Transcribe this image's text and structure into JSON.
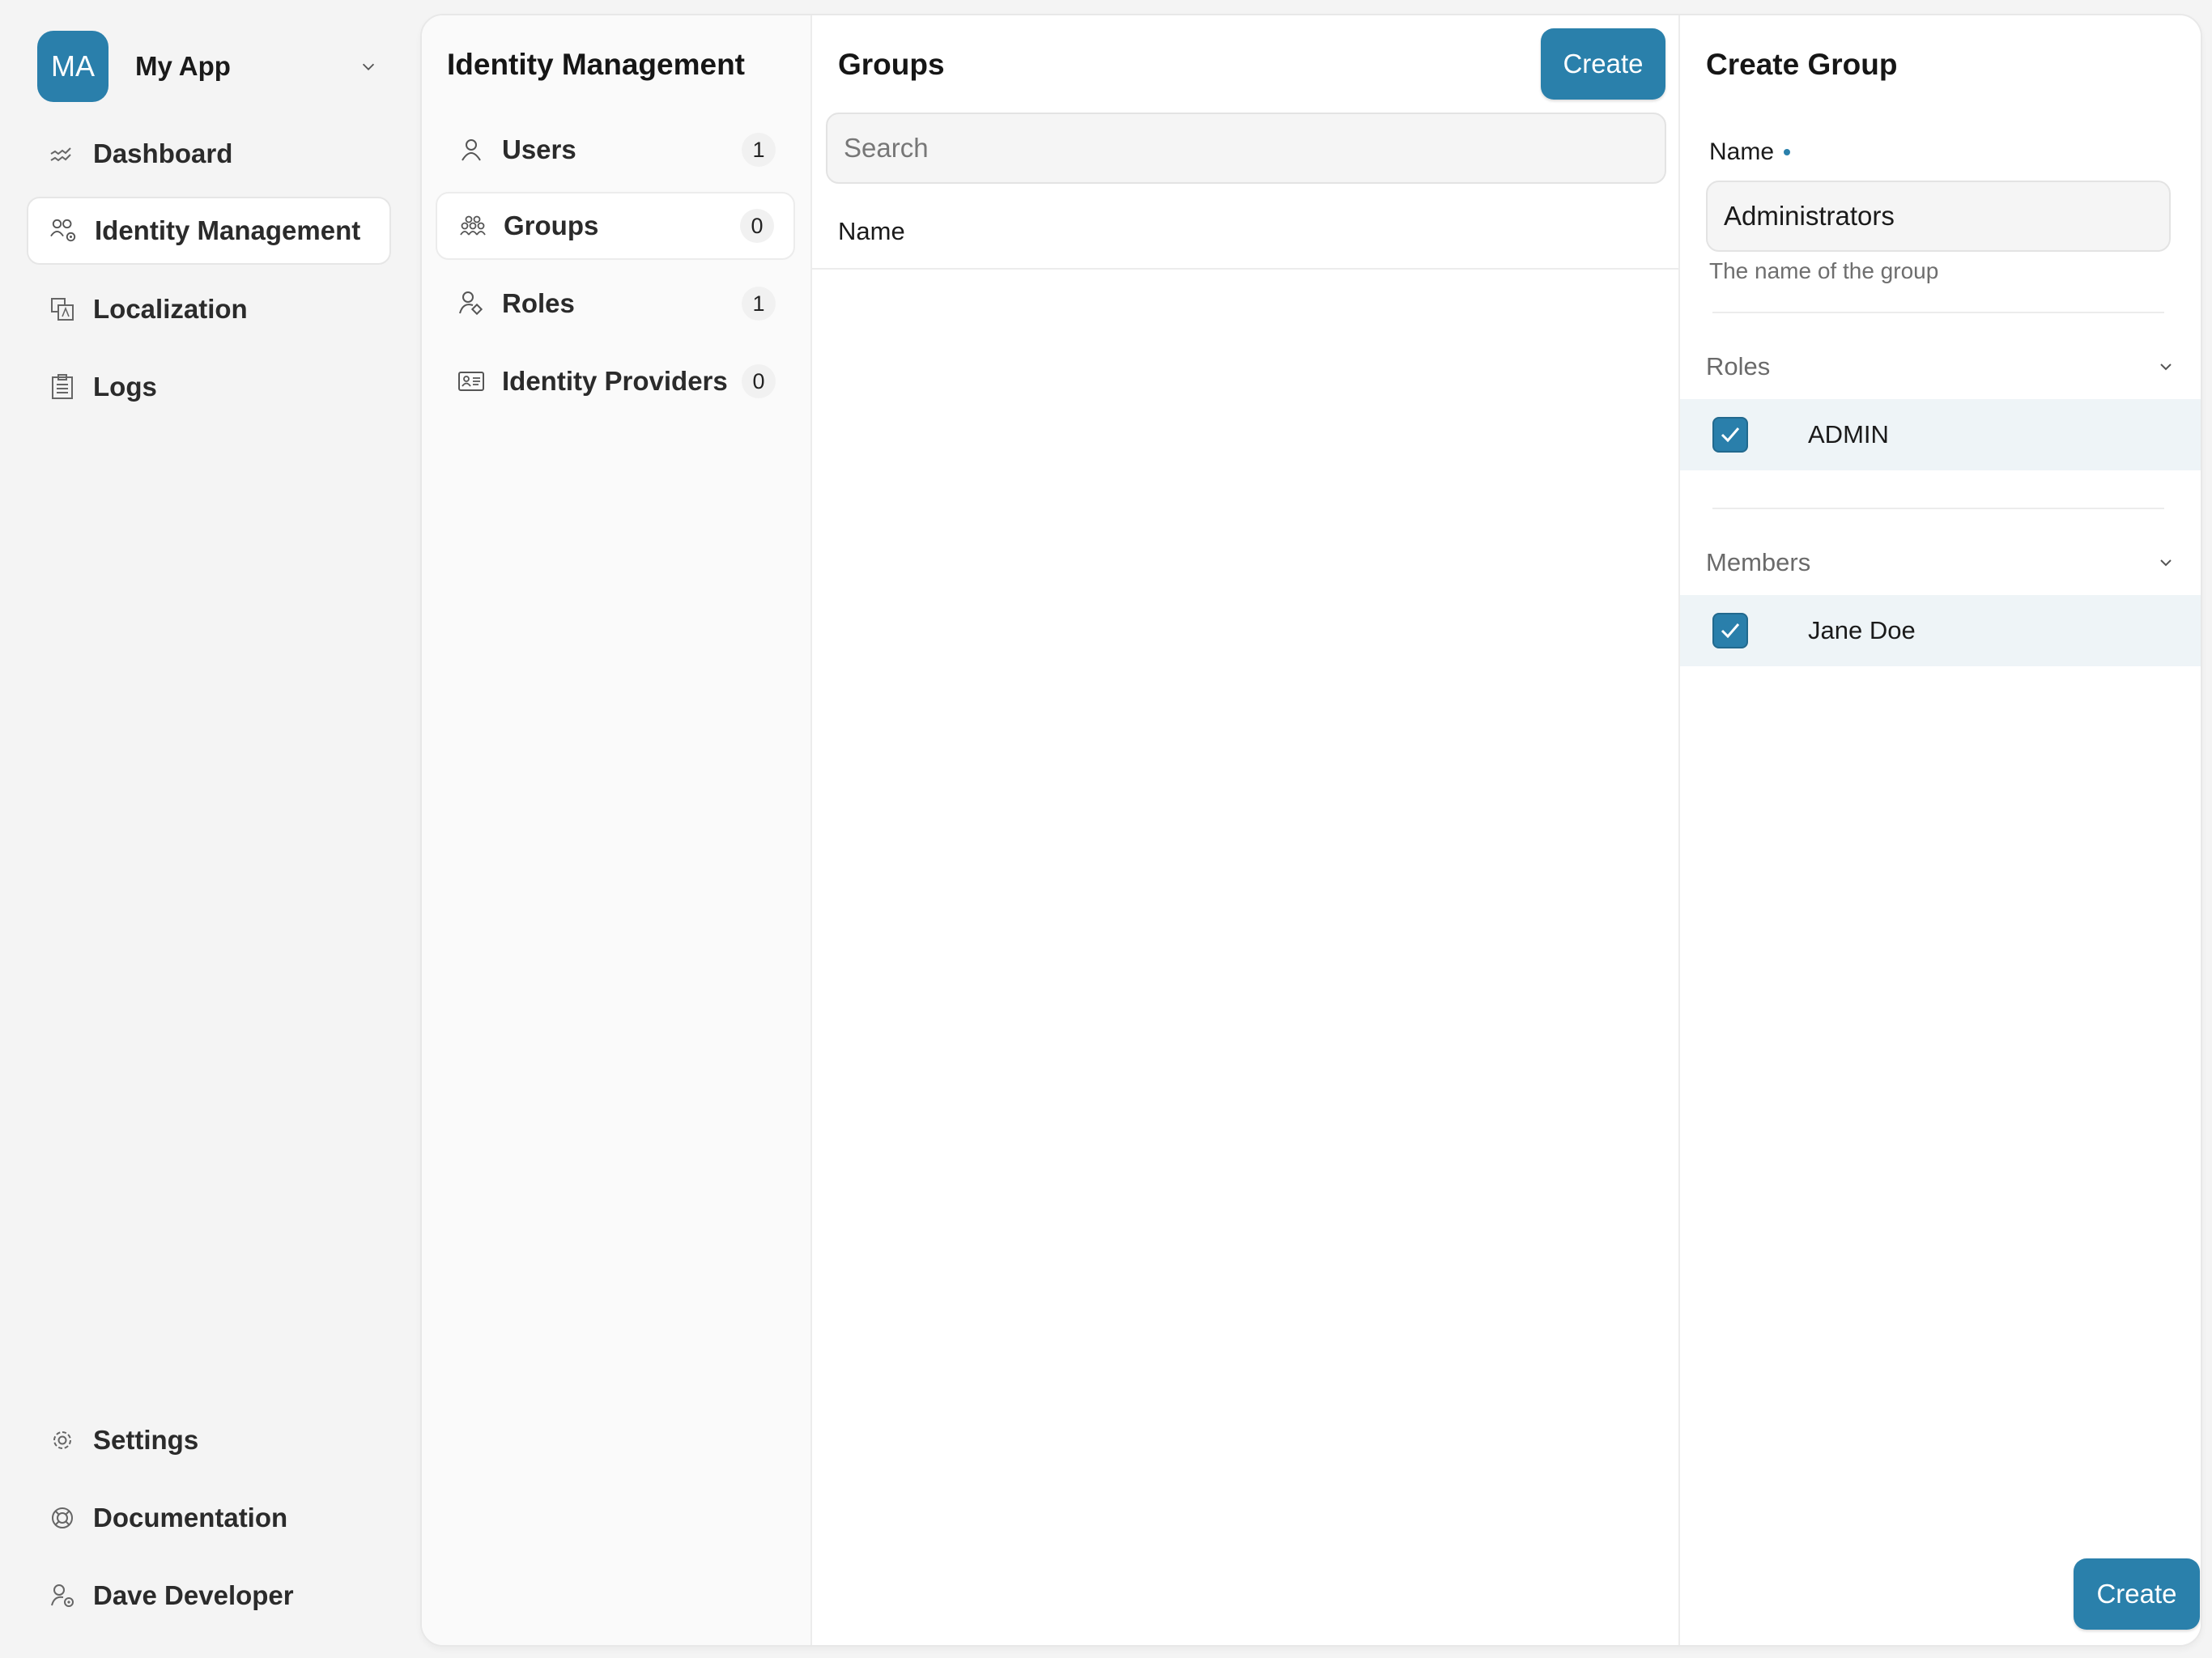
{
  "app": {
    "initials": "MA",
    "name": "My App"
  },
  "sidebar": {
    "items": [
      {
        "label": "Dashboard",
        "icon": "chart-line-icon",
        "active": false
      },
      {
        "label": "Identity Management",
        "icon": "users-gear-icon",
        "active": true
      },
      {
        "label": "Localization",
        "icon": "translate-icon",
        "active": false
      },
      {
        "label": "Logs",
        "icon": "clipboard-list-icon",
        "active": false
      }
    ],
    "footer": [
      {
        "label": "Settings",
        "icon": "gear-icon"
      },
      {
        "label": "Documentation",
        "icon": "lifebuoy-icon"
      },
      {
        "label": "Dave Developer",
        "icon": "user-gear-icon"
      }
    ]
  },
  "subnav": {
    "title": "Identity Management",
    "items": [
      {
        "label": "Users",
        "count": "1",
        "icon": "user-icon",
        "active": false
      },
      {
        "label": "Groups",
        "count": "0",
        "icon": "group-icon",
        "active": true
      },
      {
        "label": "Roles",
        "count": "1",
        "icon": "user-tag-icon",
        "active": false
      },
      {
        "label": "Identity Providers",
        "count": "0",
        "icon": "id-card-icon",
        "active": false
      }
    ]
  },
  "groups": {
    "title": "Groups",
    "create_label": "Create",
    "search_placeholder": "Search",
    "search_value": "",
    "columns": [
      "Name"
    ],
    "rows": []
  },
  "create_group": {
    "title": "Create Group",
    "name_label": "Name",
    "name_value": "Administrators",
    "name_hint": "The name of the group",
    "roles": {
      "title": "Roles",
      "items": [
        {
          "label": "ADMIN",
          "checked": true
        }
      ]
    },
    "members": {
      "title": "Members",
      "items": [
        {
          "label": "Jane Doe",
          "checked": true
        }
      ]
    },
    "submit_label": "Create"
  },
  "colors": {
    "accent": "#2a7fab",
    "selected_row": "#eef4f7",
    "background": "#f4f4f4"
  }
}
